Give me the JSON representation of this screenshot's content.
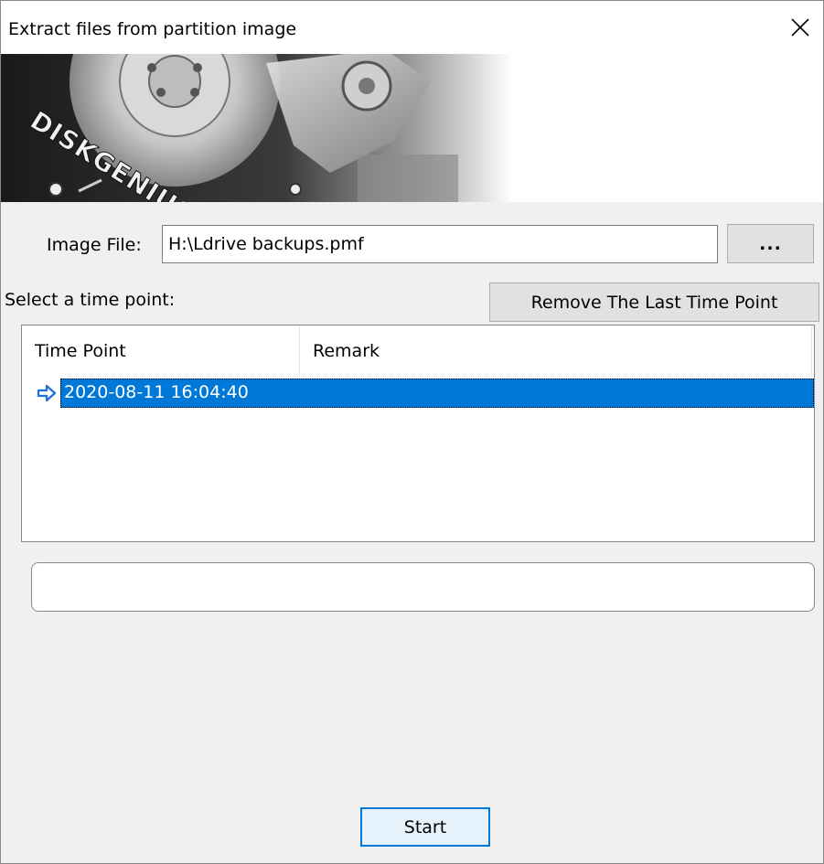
{
  "window": {
    "title": "Extract files from partition image",
    "close_icon": "close-icon"
  },
  "banner": {
    "brand": "DISKGENIUS"
  },
  "image_file": {
    "label": "Image File:",
    "value": "H:\\Ldrive backups.pmf",
    "browse_label": "..."
  },
  "time_point": {
    "label": "Select a time point:",
    "remove_button": "Remove The Last Time Point",
    "columns": [
      "Time Point",
      "Remark"
    ],
    "rows": [
      {
        "time": "2020-08-11 16:04:40",
        "remark": "",
        "selected": true,
        "icon": "arrow-right-icon"
      }
    ]
  },
  "progress": {
    "value": 0
  },
  "actions": {
    "start_label": "Start"
  },
  "colors": {
    "selection": "#0078d7",
    "dialog_bg": "#f0f0f0",
    "arrow": "#1e6fd9"
  }
}
